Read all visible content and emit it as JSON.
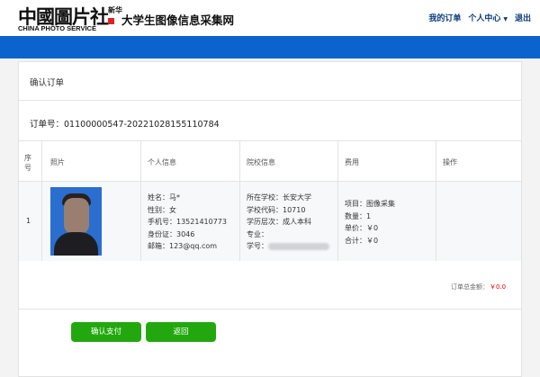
{
  "header": {
    "logo_cn": "中國圖片社",
    "logo_seal": "新华",
    "logo_en": "CHINA PHOTO SERVICE",
    "site_title": "大学生图像信息采集网",
    "nav": {
      "my_orders": "我的订单",
      "personal_center": "个人中心",
      "caret": "▼",
      "logout": "退出"
    }
  },
  "page": {
    "section_title": "确认订单",
    "order_number_label": "订单号：",
    "order_number": "01100000547-20221028155110784"
  },
  "table": {
    "headers": [
      "序号",
      "照片",
      "个人信息",
      "院校信息",
      "费用",
      "操作"
    ],
    "row": {
      "index": "1",
      "personal": {
        "name": "姓名：马*",
        "gender": "性别：女",
        "phone": "手机号：13521410773",
        "id_card": "身份证：3046",
        "email": "邮箱：123@qq.com"
      },
      "school": {
        "school_name": "所在学校：长安大学",
        "school_code": "学校代码：10710",
        "level": "学历层次：成人本科",
        "major": "专业：",
        "student_id": "学号："
      },
      "fee": {
        "item": "项目：图像采集",
        "quantity": "数量：1",
        "unit_price": "单价：￥0",
        "total": "合计：￥0"
      }
    }
  },
  "summary": {
    "total_label": "订单总金额：",
    "total_value": "￥0.0"
  },
  "actions": {
    "confirm_pay": "确认支付",
    "back": "返回"
  },
  "colors": {
    "accent_blue": "#0b63ce",
    "button_green": "#22a80e",
    "price_red": "#e00000"
  }
}
